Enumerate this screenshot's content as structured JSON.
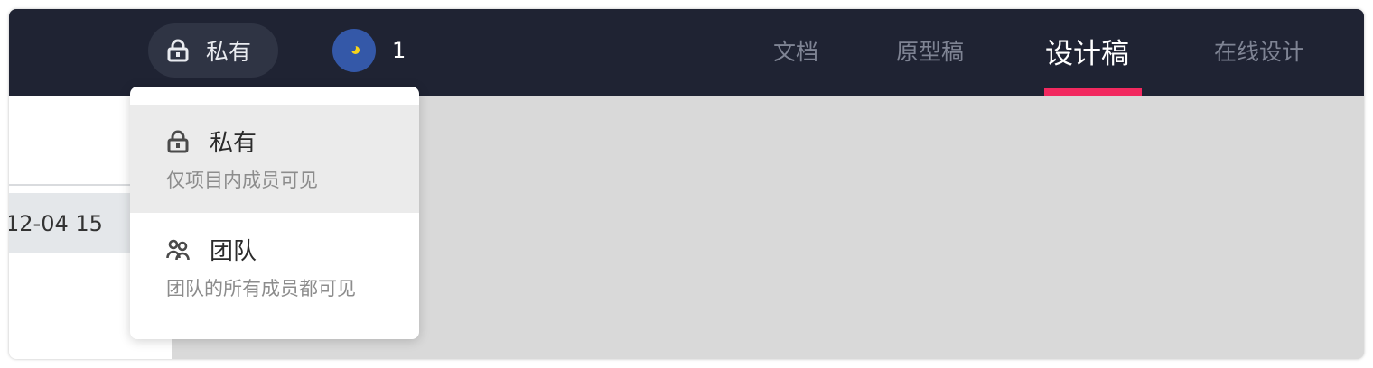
{
  "header": {
    "privacy": {
      "label": "私有",
      "icon": "lock-icon"
    },
    "member": {
      "count": "1",
      "avatar_color": "#3458a8"
    },
    "tabs": [
      {
        "label": "文档",
        "active": false
      },
      {
        "label": "原型稿",
        "active": false
      },
      {
        "label": "设计稿",
        "active": true
      },
      {
        "label": "在线设计",
        "active": false
      }
    ],
    "accent_color": "#f2295f",
    "background_color": "#1f2333"
  },
  "left_panel": {
    "row_text": "12-04 15"
  },
  "dropdown": {
    "options": [
      {
        "title": "私有",
        "description": "仅项目内成员可见",
        "icon": "lock-icon",
        "selected": true
      },
      {
        "title": "团队",
        "description": "团队的所有成员都可见",
        "icon": "team-icon",
        "selected": false
      }
    ]
  }
}
